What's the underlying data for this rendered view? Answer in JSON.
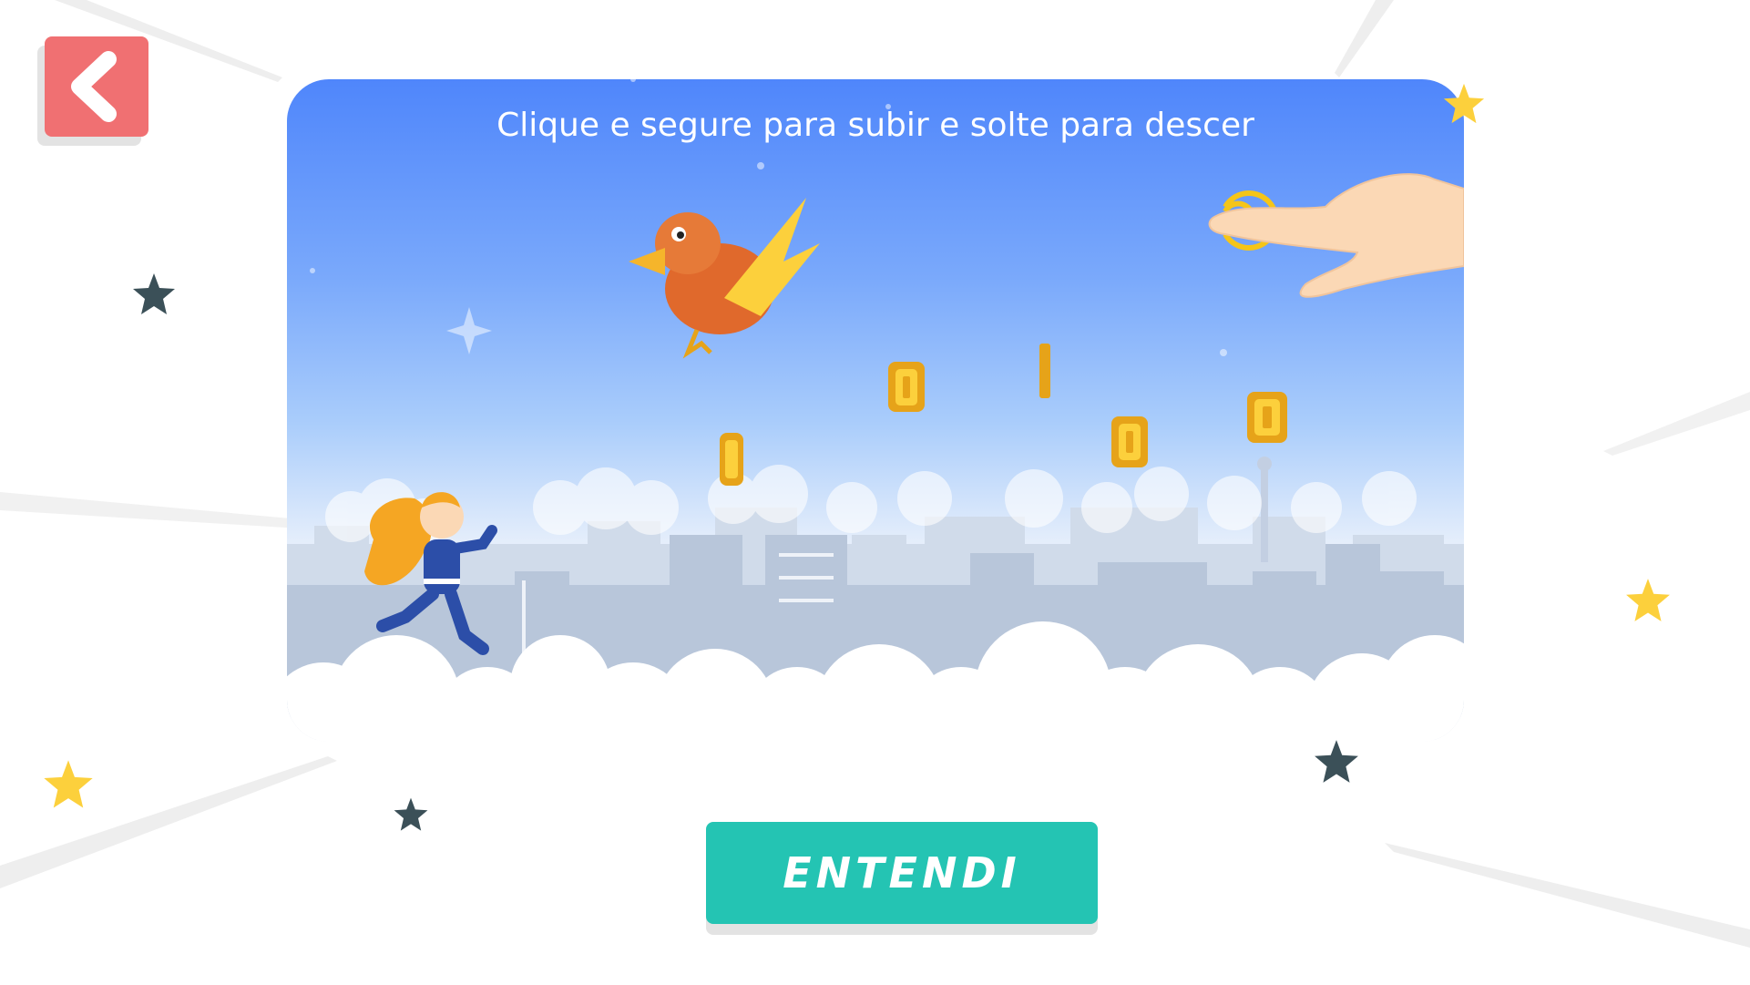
{
  "instruction": "Clique e segure para subir e solte para descer",
  "confirm_button": {
    "label": "ENTENDI"
  },
  "colors": {
    "back_button": "#f07072",
    "confirm_button": "#24c4b3",
    "star_yellow": "#fcd03c",
    "star_dark": "#3b5058"
  },
  "icons": {
    "back": "chevron-left-icon",
    "tap_hint": "pointing-hand-icon",
    "coin": "coin-icon",
    "star": "star-icon"
  }
}
